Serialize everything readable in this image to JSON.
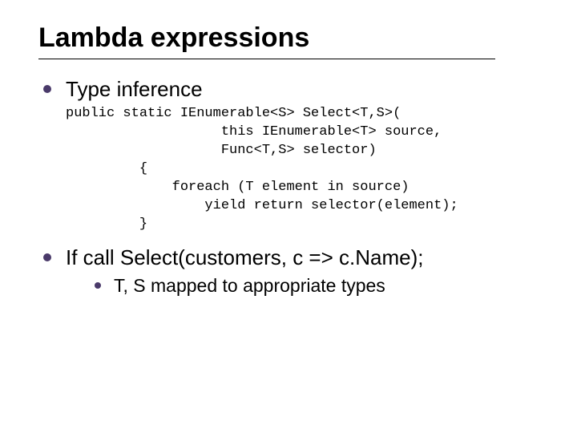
{
  "title": "Lambda expressions",
  "bullets": {
    "b1": "Type inference",
    "b2": "If call Select(customers, c => c.Name);",
    "b2_sub1": "T, S mapped to appropriate types"
  },
  "code": "public static IEnumerable<S> Select<T,S>(\n                   this IEnumerable<T> source,\n                   Func<T,S> selector)\n         {\n             foreach (T element in source)\n                 yield return selector(element);\n         }"
}
